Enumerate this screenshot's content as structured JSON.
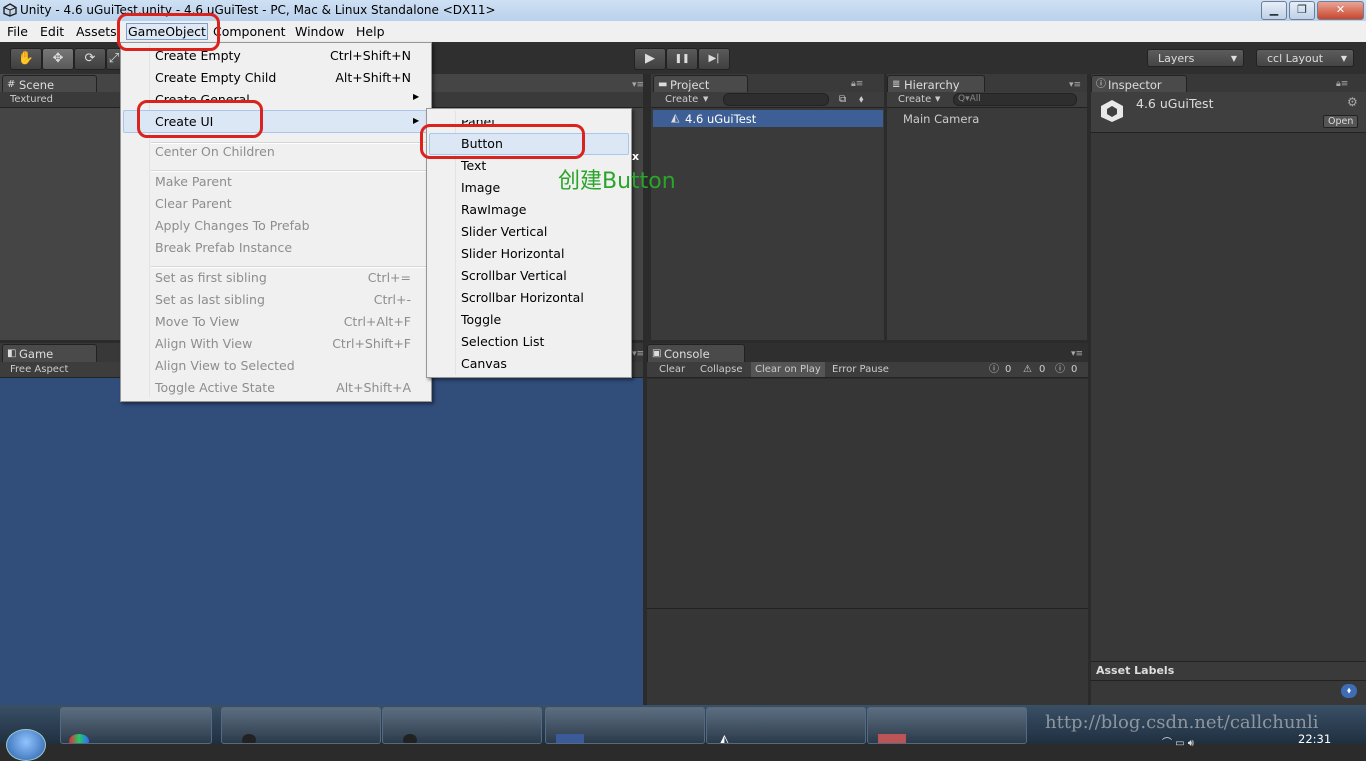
{
  "window": {
    "title": "Unity - 4.6 uGuiTest.unity - 4.6 uGuiTest - PC, Mac & Linux Standalone <DX11>",
    "buttons": [
      "▁",
      "❐",
      "✕"
    ]
  },
  "menubar": [
    "File",
    "Edit",
    "Assets",
    "GameObject",
    "Component",
    "Window",
    "Help"
  ],
  "toolbar": {
    "tools": [
      "✋",
      "✥",
      "⟳",
      "⤢"
    ],
    "play": [
      "▶",
      "❚❚",
      "▶|"
    ],
    "layers_label": "Layers",
    "layout_label": "ccl Layout"
  },
  "scene": {
    "tab": "Scene",
    "mode": "Textured"
  },
  "game": {
    "tab": "Game",
    "aspect": "Free Aspect"
  },
  "project": {
    "tab": "Project",
    "create": "Create",
    "item": "4.6 uGuiTest"
  },
  "hierarchy": {
    "tab": "Hierarchy",
    "create": "Create",
    "search_placeholder": "Q▾All",
    "item": "Main Camera"
  },
  "inspector": {
    "tab": "Inspector",
    "object": "4.6 uGuiTest",
    "open": "Open",
    "asset_labels": "Asset Labels"
  },
  "console": {
    "tab": "Console",
    "buttons": [
      "Clear",
      "Collapse",
      "Clear on Play",
      "Error Pause"
    ],
    "counts": [
      "0",
      "0",
      "0"
    ]
  },
  "gameobject_menu": {
    "items": [
      {
        "label": "Create Empty",
        "shortcut": "Ctrl+Shift+N",
        "disabled": false
      },
      {
        "label": "Create Empty Child",
        "shortcut": "Alt+Shift+N",
        "disabled": false
      },
      {
        "label": "Create General",
        "shortcut": "",
        "disabled": false
      },
      {
        "label": "Create UI",
        "shortcut": "",
        "disabled": false
      },
      {
        "label": "Center On Children",
        "shortcut": "",
        "disabled": true
      },
      {
        "label": "Make Parent",
        "shortcut": "",
        "disabled": true
      },
      {
        "label": "Clear Parent",
        "shortcut": "",
        "disabled": true
      },
      {
        "label": "Apply Changes To Prefab",
        "shortcut": "",
        "disabled": true
      },
      {
        "label": "Break Prefab Instance",
        "shortcut": "",
        "disabled": true
      },
      {
        "label": "Set as first sibling",
        "shortcut": "Ctrl+=",
        "disabled": true
      },
      {
        "label": "Set as last sibling",
        "shortcut": "Ctrl+-",
        "disabled": true
      },
      {
        "label": "Move To View",
        "shortcut": "Ctrl+Alt+F",
        "disabled": true
      },
      {
        "label": "Align With View",
        "shortcut": "Ctrl+Shift+F",
        "disabled": true
      },
      {
        "label": "Align View to Selected",
        "shortcut": "",
        "disabled": true
      },
      {
        "label": "Toggle Active State",
        "shortcut": "Alt+Shift+A",
        "disabled": true
      }
    ]
  },
  "create_ui_menu": {
    "items": [
      "Panel",
      "Button",
      "Text",
      "Image",
      "RawImage",
      "Slider Vertical",
      "Slider Horizontal",
      "Scrollbar Vertical",
      "Scrollbar Horizontal",
      "Toggle",
      "Selection List",
      "Canvas"
    ]
  },
  "annotation": {
    "text": "创建Button",
    "color": "#2aa52a"
  },
  "watermark": "http://blog.csdn.net/callchunli",
  "taskbar": {
    "clock": "22:31"
  },
  "colors": {
    "highlight": "#d9231c",
    "game_bg": "#314d7a",
    "selected_row": "#3e5f96"
  }
}
